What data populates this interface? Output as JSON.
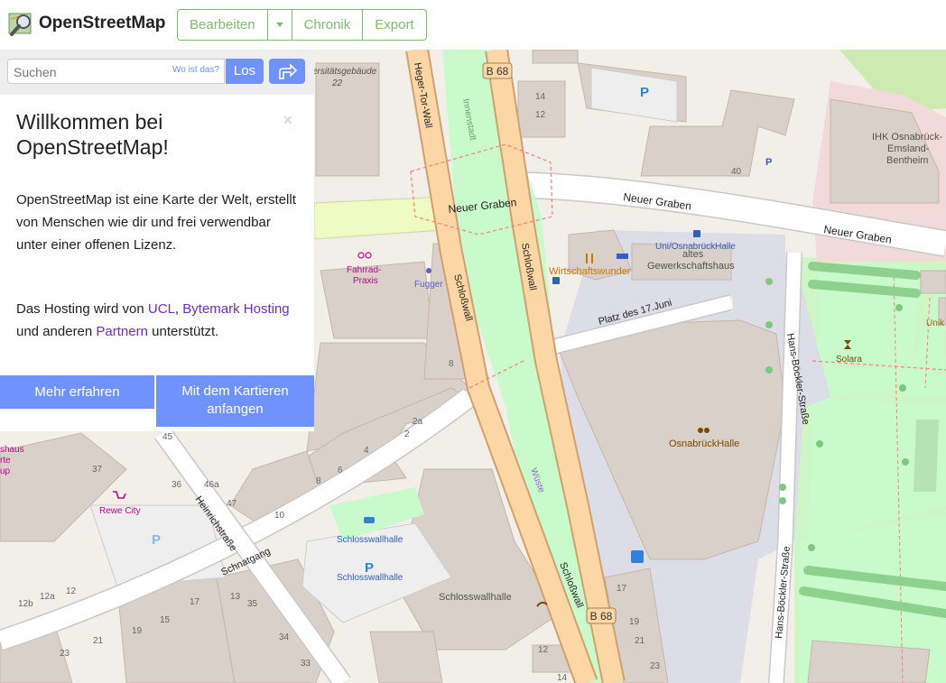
{
  "header": {
    "logo_text": "OpenStreetMap",
    "tabs": [
      {
        "label": "Bearbeiten"
      },
      {
        "label": "Chronik"
      },
      {
        "label": "Export"
      }
    ]
  },
  "search": {
    "placeholder": "Suchen",
    "where_link": "Wo ist das?",
    "go_label": "Los"
  },
  "welcome": {
    "title": "Willkommen bei OpenStreetMap!",
    "close": "×",
    "intro": "OpenStreetMap ist eine Karte der Welt, erstellt von Menschen wie dir und frei verwendbar unter einer offenen Lizenz.",
    "hosting": {
      "prefix": "Das Hosting wird von",
      "ucl": "UCL",
      "comma": ",",
      "bytemark": "Bytemark Hosting",
      "middle": "und anderen",
      "partners": "Partnern",
      "suffix": "unterstützt."
    },
    "learn_more": "Mehr erfahren",
    "start_mapping": "Mit dem Kartieren anfangen"
  },
  "map": {
    "labels": {
      "univ": "ersitätsgebäude",
      "univ_no": "22",
      "heger": "Heger-Tor-Wall",
      "innenstadt": "Innenstadt",
      "b68": "B 68",
      "neuer_graben": "Neuer Graben",
      "schlosswall": "Schloßwall",
      "wirtschaft": "Wirtschaftswunder",
      "uni_halle": "Uni/OsnabrückHalle",
      "altes1": "altes",
      "altes2": "Gewerkschaftshaus",
      "platz": "Platz des 17.Juni",
      "hans": "Hans-Böckler-Straße",
      "ihk1": "IHK Osnabrück-",
      "ihk2": "Emsland-",
      "ihk3": "Bentheim",
      "solara": "Solara",
      "unik": "Unik",
      "osnahalle": "OsnabrückHalle",
      "fahrrad1": "Fahrrad-",
      "fahrrad2": "Praxis",
      "fugger": "Fugger",
      "rewe": "Rewe City",
      "heinrich": "Heinrichstraße",
      "schnatgang": "Schnatgang",
      "schlosswallhalle": "Schlosswallhalle",
      "wueste": "Wüste",
      "haus1": "shaus",
      "haus2": "rte",
      "haus3": "up",
      "parking": "P"
    },
    "numbers": [
      "14",
      "12",
      "40",
      "8",
      "2a",
      "2",
      "4",
      "6",
      "8",
      "10",
      "37",
      "36",
      "46a",
      "47",
      "45",
      "12b",
      "12a",
      "12",
      "13",
      "35",
      "17",
      "15",
      "21",
      "19",
      "23",
      "34",
      "33",
      "17",
      "19",
      "21",
      "23",
      "12",
      "14"
    ]
  },
  "colors": {
    "accent": "#7092ff",
    "brand_green": "#7ebc6f",
    "primary_road": "#fcd6a4",
    "pedestrian": "#dddde8",
    "park": "#c8facc",
    "building": "#d9d0c9"
  }
}
